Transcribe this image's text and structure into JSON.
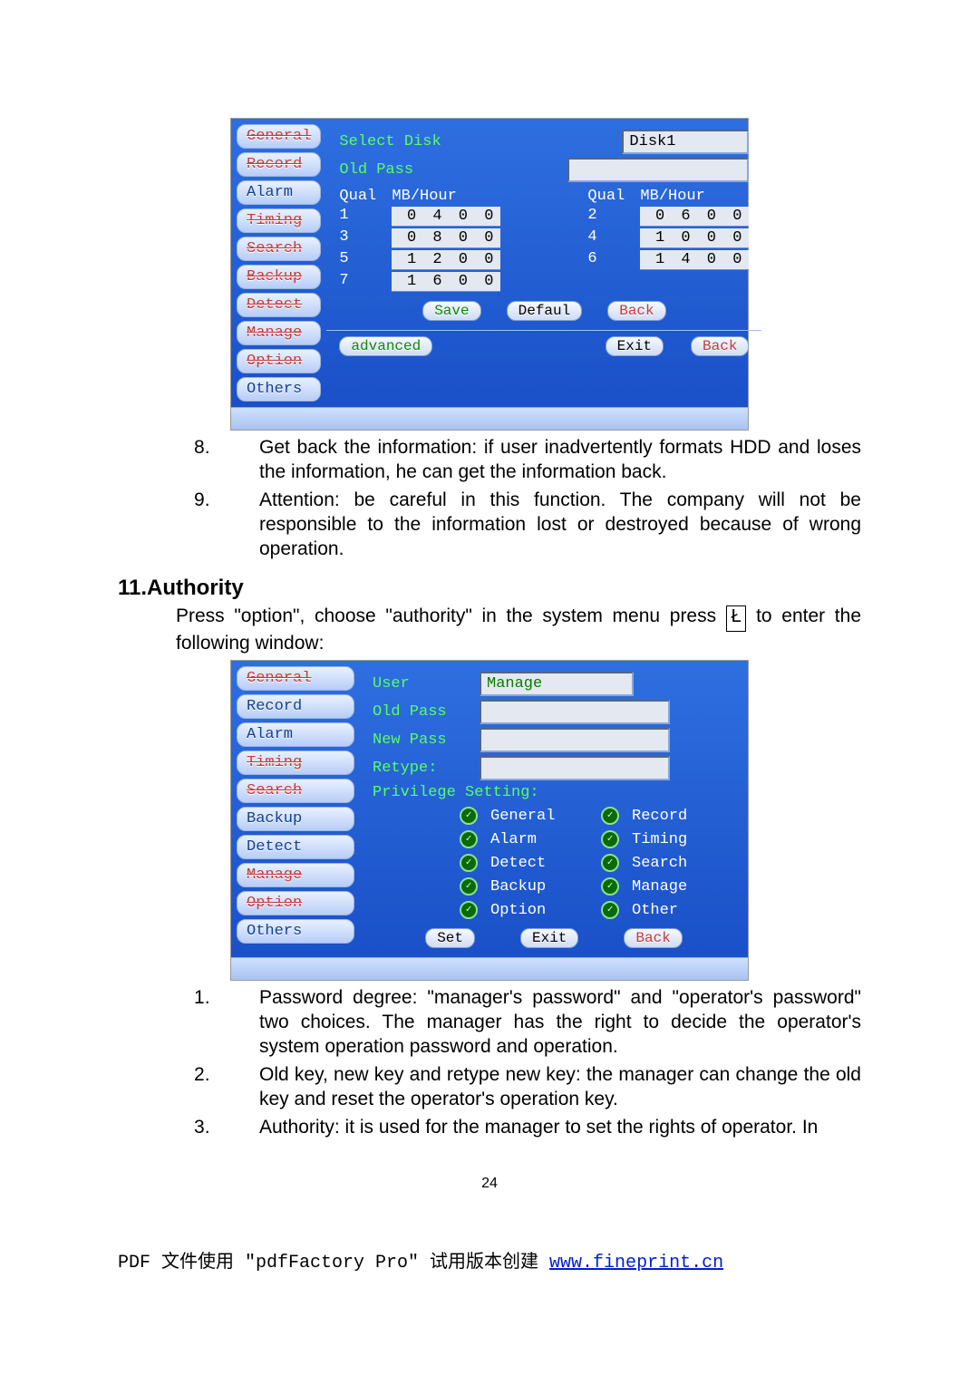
{
  "panel1": {
    "sidebar": [
      "General",
      "Record",
      "Alarm",
      "Timing",
      "Search",
      "Backup",
      "Detect",
      "Manage",
      "Option",
      "Others"
    ],
    "select_disk_lbl": "Select Disk",
    "select_disk_val": "Disk1",
    "old_pass_lbl": "Old Pass",
    "old_pass_val": "",
    "hdr_qual": "Qual",
    "hdr_mbh": "MB/Hour",
    "rows": [
      {
        "q": "1",
        "v": "0 4 0 0",
        "q2": "2",
        "v2": "0 6 0 0"
      },
      {
        "q": "3",
        "v": "0 8 0 0",
        "q2": "4",
        "v2": "1 0 0 0"
      },
      {
        "q": "5",
        "v": "1 2 0 0",
        "q2": "6",
        "v2": "1 4 0 0"
      },
      {
        "q": "7",
        "v": "1 6 0 0",
        "q2": "",
        "v2": ""
      }
    ],
    "btn_save": "Save",
    "btn_default": "Defaul",
    "btn_back": "Back",
    "btn_advanced": "advanced",
    "btn_exit": "Exit",
    "btn_back2": "Back"
  },
  "body1": {
    "items": [
      "Get back the information: if user inadvertently formats HDD and loses the information, he can get the information back.",
      "Attention: be careful in this function. The company will not be responsible to the information lost or destroyed because of wrong operation."
    ]
  },
  "section_title": "11.Authority",
  "section_intro_a": "Press \"option\", choose \"authority\" in the system menu press ",
  "section_key": "Ł",
  "section_intro_b": " to enter the following window:",
  "panel2": {
    "sidebar": [
      "General",
      "Record",
      "Alarm",
      "Timing",
      "Search",
      "Backup",
      "Detect",
      "Manage",
      "Option",
      "Others"
    ],
    "user_lbl": "User",
    "user_val": "Manage",
    "old_pass_lbl": "Old Pass",
    "old_pass_val": "",
    "new_pass_lbl": "New Pass",
    "new_pass_val": "",
    "retype_lbl": "Retype:",
    "retype_val": "",
    "priv_lbl": "Privilege Setting:",
    "privs": [
      [
        "General",
        "Record"
      ],
      [
        "Alarm",
        "Timing"
      ],
      [
        "Detect",
        "Search"
      ],
      [
        "Backup",
        "Manage"
      ],
      [
        "Option",
        "Other"
      ]
    ],
    "btn_set": "Set",
    "btn_exit": "Exit",
    "btn_back": "Back"
  },
  "body2": {
    "items": [
      "Password degree: \"manager's password\" and \"operator's password\" two choices. The manager has the right to decide the operator's system operation password and operation.",
      "Old key, new key and retype new key: the manager can change the old key and reset the operator's operation key.",
      "Authority: it is used for the manager to set the rights of operator. In"
    ]
  },
  "page_number": "24",
  "pdf_footer_a": "PDF 文件使用 \"pdfFactory Pro\" 试用版本创建 ",
  "pdf_footer_link": "www.fineprint.cn"
}
